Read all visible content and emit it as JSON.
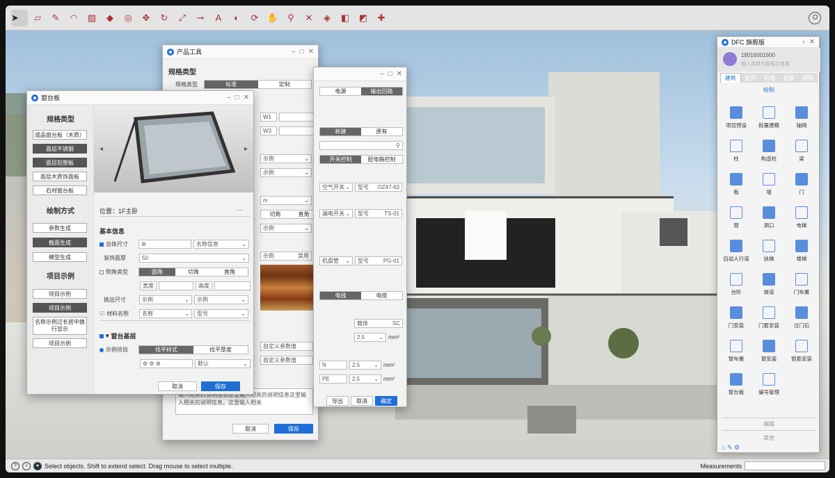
{
  "status": {
    "hint": "Select objects. Shift to extend select. Drag mouse to select multiple.",
    "measurements_label": "Measurements"
  },
  "toolbar": {
    "tools": [
      "select-icon",
      "eraser-icon",
      "pencil-icon",
      "arc-icon",
      "rectangle-icon",
      "push-pull-icon",
      "offset-icon",
      "move-icon",
      "rotate-icon",
      "scale-icon",
      "tape-icon",
      "text-icon",
      "paint-icon",
      "orbit-icon",
      "pan-icon",
      "zoom-icon",
      "zoom-extents-icon",
      "section-icon",
      "component-icon",
      "warehouse-icon",
      "extension-icon"
    ]
  },
  "product_tool": {
    "title": "产品工具",
    "spec_type": "规格类型",
    "spec_type_label": "规格类型",
    "seg_standard": "标准",
    "seg_custom": "定制",
    "w1": "W1",
    "w3": "W3",
    "example": "示例",
    "m": "m",
    "corner_a": "切角",
    "corner_b": "直角",
    "disabled": "禁用",
    "custom_param": "自定义参数值",
    "desc": "输入相关的说明信息这里输入相关的说明信息这里输入相关的说明信息。这里输入相关",
    "cancel": "取消",
    "save": "保存"
  },
  "electric": {
    "tab_power": "电源",
    "tab_loop": "输出回路",
    "new": "新建",
    "original": "原有",
    "switch_ctrl": "开关控制",
    "box_ctrl": "配电箱控制",
    "air_switch": "空气开关",
    "model": "型号",
    "model1": "OZ47-63",
    "leak_switch": "漏电开关",
    "model2": "TS-01",
    "panel": "机盘管",
    "model3": "PG-01",
    "wire": "电线",
    "cable": "电缆",
    "carrier": "载体",
    "sc": "SC",
    "v25a": "2.5",
    "mm2": "mm²",
    "n": "N",
    "pe": "PE",
    "export": "导出",
    "cancel": "取消",
    "ok": "确定"
  },
  "window_sill": {
    "title": "窗台板",
    "spec_type": "规格类型",
    "types": [
      "成品窗台板（木质）",
      "面层不锈钢",
      "面层铝塑板",
      "面层木质饰面板",
      "石材窗台板"
    ],
    "draw_mode": "绘制方式",
    "modes": [
      "参数生成",
      "截面生成",
      "模型生成"
    ],
    "example_title": "项目示例",
    "examples": [
      "项目示例",
      "项目示例",
      "名称示例过长居中换行显示",
      "项目示例"
    ],
    "location": "位置：1F主卧",
    "more": "···",
    "basic_info": "基本信息",
    "overall_size": "总体尺寸",
    "name_info": "名称信息",
    "finish_thickness": "装饰面厚",
    "thickness_val": "50",
    "chamfer_type": "倒角类型",
    "round": "圆角",
    "cut": "切角",
    "straight": "直角",
    "width": "宽度",
    "height": "高度",
    "overhang": "挑出尺寸",
    "example": "示例",
    "material": "材料名称",
    "name": "名称",
    "model": "型号",
    "base_layer": "窗台基层",
    "example_item": "示例项目",
    "level_style": "找平样式",
    "level_thick": "找平厚度",
    "default": "默认",
    "cancel": "取消",
    "save": "保存"
  },
  "dfc_panel": {
    "title": "DFC 旗舰版",
    "user_id": "18016001600",
    "user_sub": "输入选择方案索引查看",
    "tabs": [
      "建筑",
      "室内",
      "机电",
      "批量",
      "通用"
    ],
    "section": "绘制",
    "tools": [
      "项目预设",
      "批量建模",
      "轴网",
      "柱",
      "构造柱",
      "梁",
      "板",
      "墙",
      "门",
      "窗",
      "洞口",
      "电梯",
      "自动人行道",
      "扶梯",
      "楼梯",
      "台阶",
      "坡道",
      "门布置",
      "门安装",
      "门套安装",
      "过门石",
      "窗布置",
      "窗安装",
      "窗套安装",
      "窗台板",
      "编号管理"
    ],
    "edit": "编辑",
    "other": "其他"
  }
}
